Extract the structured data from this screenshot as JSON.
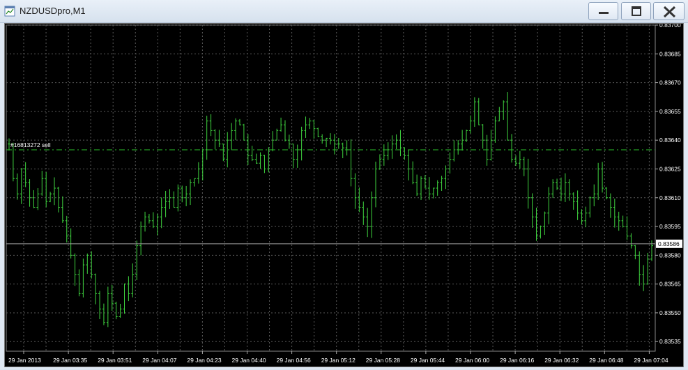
{
  "window": {
    "title": "NZDUSDpro,M1",
    "icon": "chart-window-icon",
    "buttons": [
      "minimize-icon",
      "maximize-icon",
      "close-icon"
    ]
  },
  "chart_data": {
    "type": "bar",
    "style": "ohlc-bars",
    "symbol": "NZDUSDpro",
    "timeframe": "M1",
    "colors": {
      "background": "#000000",
      "bars": "#3fd43f",
      "grid": "#5a5a5a",
      "axis_text": "#ffffff",
      "order_line": "#2bbf2b",
      "bid_line": "#a0a0a0"
    },
    "grid": true,
    "ylim": [
      0.8353,
      0.837
    ],
    "y_ticks": [
      "0.83700",
      "0.83685",
      "0.83670",
      "0.83655",
      "0.83640",
      "0.83625",
      "0.83610",
      "0.83595",
      "0.83580",
      "0.83565",
      "0.83550",
      "0.83535"
    ],
    "x_ticks": [
      "29 Jan 2013",
      "29 Jan 03:35",
      "29 Jan 03:51",
      "29 Jan 04:07",
      "29 Jan 04:23",
      "29 Jan 04:40",
      "29 Jan 04:56",
      "29 Jan 05:12",
      "29 Jan 05:28",
      "29 Jan 05:44",
      "29 Jan 06:00",
      "29 Jan 06:16",
      "29 Jan 06:32",
      "29 Jan 06:48",
      "29 Jan 07:04"
    ],
    "current_price": {
      "value": 0.83586,
      "label": "0.83586"
    },
    "order": {
      "label": "#16813272 sell",
      "price": 0.83635
    },
    "series": [
      {
        "values": [
          0.83638,
          0.8362,
          0.83612,
          0.83625,
          0.83618,
          0.8361,
          0.83605,
          0.83612,
          0.8362,
          0.83608,
          0.83612,
          0.83615,
          0.83605,
          0.83598,
          0.8359,
          0.8358,
          0.8357,
          0.8356,
          0.83575,
          0.8358,
          0.8357,
          0.8356,
          0.83552,
          0.83545,
          0.8356,
          0.83555,
          0.83548,
          0.83552,
          0.83565,
          0.8356,
          0.8357,
          0.83585,
          0.83595,
          0.836,
          0.83598,
          0.83595,
          0.836,
          0.83605,
          0.83608,
          0.8361,
          0.83605,
          0.83615,
          0.8361,
          0.83612,
          0.83618,
          0.8362,
          0.83625,
          0.83635,
          0.8365,
          0.83645,
          0.8364,
          0.83638,
          0.8363,
          0.8364,
          0.83645,
          0.8365,
          0.83648,
          0.8364,
          0.83632,
          0.8363,
          0.83628,
          0.83632,
          0.83625,
          0.83635,
          0.8364,
          0.83645,
          0.83648,
          0.8364,
          0.83638,
          0.8363,
          0.83635,
          0.83645,
          0.83648,
          0.8365,
          0.83646,
          0.83642,
          0.8364,
          0.83641,
          0.8364,
          0.83638,
          0.83638,
          0.83636,
          0.83635,
          0.8362,
          0.8361,
          0.83605,
          0.836,
          0.83595,
          0.8361,
          0.83625,
          0.8363,
          0.83632,
          0.83635,
          0.83638,
          0.8364,
          0.83636,
          0.83632,
          0.83625,
          0.83618,
          0.83612,
          0.8362,
          0.83615,
          0.83612,
          0.83615,
          0.83618,
          0.8362,
          0.83625,
          0.8363,
          0.83635,
          0.83638,
          0.8364,
          0.83645,
          0.8365,
          0.8366,
          0.83648,
          0.8364,
          0.8363,
          0.8364,
          0.8365,
          0.83655,
          0.8366,
          0.8364,
          0.8363,
          0.83628,
          0.8363,
          0.83625,
          0.8361,
          0.836,
          0.8359,
          0.83595,
          0.83602,
          0.83612,
          0.83618,
          0.83615,
          0.83612,
          0.83618,
          0.83612,
          0.83608,
          0.83602,
          0.83598,
          0.83602,
          0.8361,
          0.83612,
          0.83625,
          0.83615,
          0.8361,
          0.83605,
          0.836,
          0.83598,
          0.83595,
          0.8359,
          0.83585,
          0.8358,
          0.8357,
          0.83565,
          0.83578,
          0.83585
        ]
      }
    ]
  }
}
